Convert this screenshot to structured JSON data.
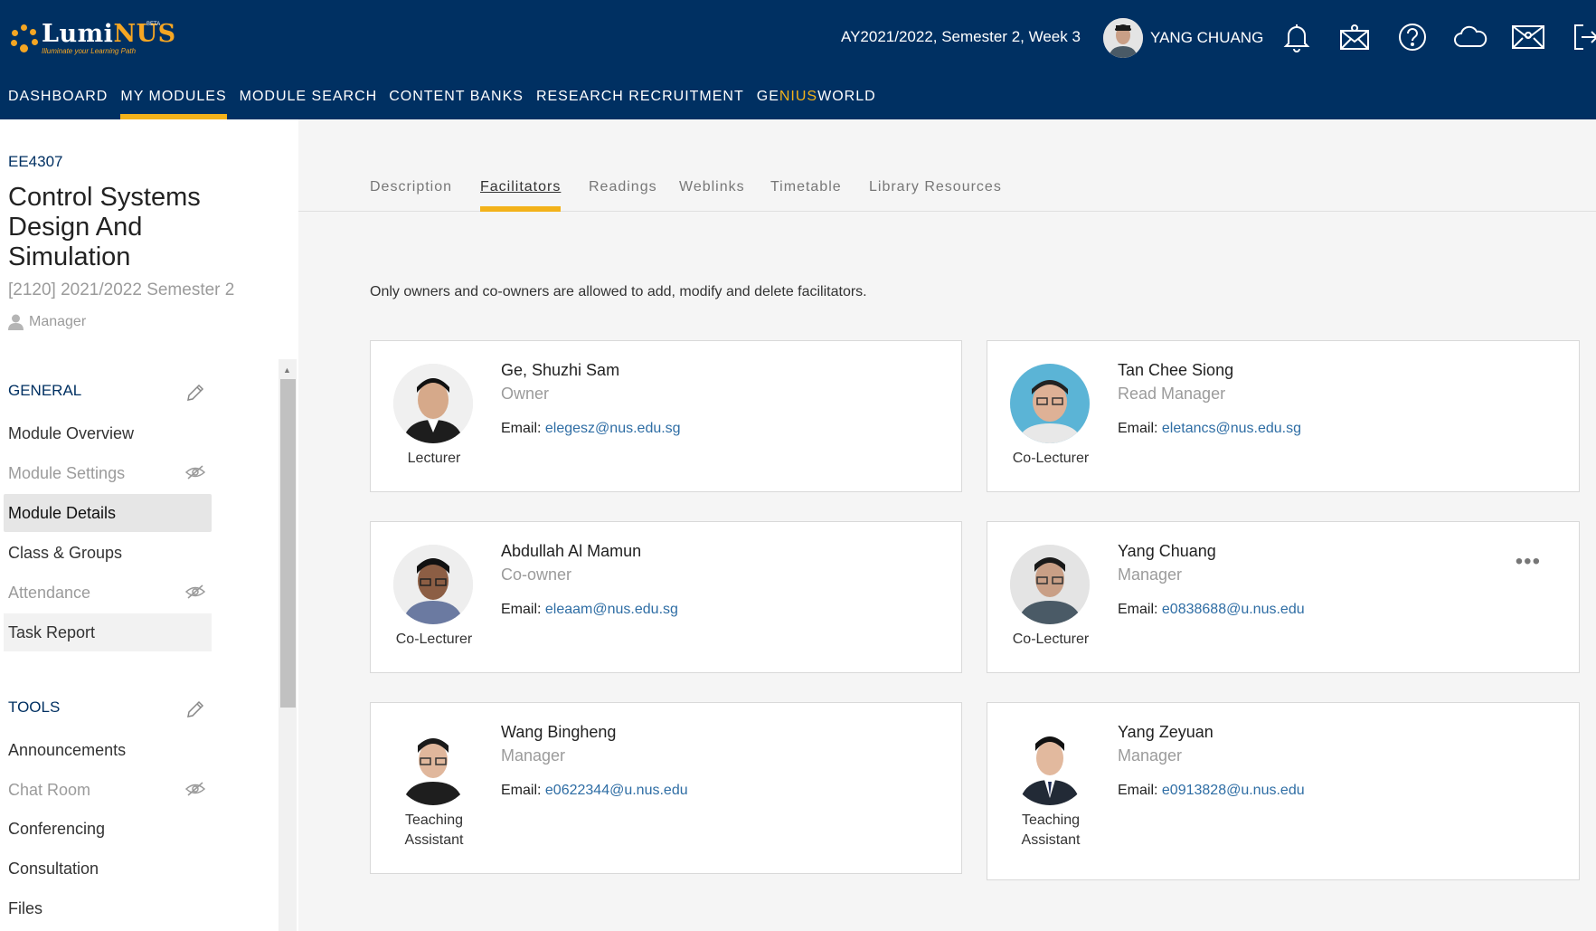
{
  "app": {
    "logo_main": "Lumi",
    "logo_nus": "NUS",
    "logo_beta": "BETA",
    "logo_tagline": "Illuminate your Learning Path"
  },
  "header": {
    "term": "AY2021/2022, Semester 2, Week 3",
    "user_name": "YANG CHUANG"
  },
  "nav": {
    "dashboard": "DASHBOARD",
    "my_modules": "MY MODULES",
    "module_search": "MODULE SEARCH",
    "content_banks": "CONTENT BANKS",
    "research_recruitment": "RESEARCH RECRUITMENT",
    "genius_a": "GE",
    "genius_b": "NIUS",
    "genius_c": "WORLD"
  },
  "module": {
    "code": "EE4307",
    "title": "Control Systems Design And Simulation",
    "term": "[2120] 2021/2022 Semester 2",
    "role": "Manager"
  },
  "sidebar": {
    "general_heading": "GENERAL",
    "general_items": [
      "Module Overview",
      "Module Settings",
      "Module Details",
      "Class & Groups",
      "Attendance",
      "Task Report"
    ],
    "tools_heading": "TOOLS",
    "tools_items": [
      "Announcements",
      "Chat Room",
      "Conferencing",
      "Consultation",
      "Files"
    ]
  },
  "tabs": {
    "description": "Description",
    "facilitators": "Facilitators",
    "readings": "Readings",
    "weblinks": "Weblinks",
    "timetable": "Timetable",
    "library": "Library Resources"
  },
  "notice": "Only owners and co-owners are allowed to add, modify and delete facilitators.",
  "email_label": "Email:",
  "facilitators": [
    {
      "name": "Ge, Shuzhi Sam",
      "role": "Owner",
      "title": "Lecturer",
      "email": "elegesz@nus.edu.sg"
    },
    {
      "name": "Tan Chee Siong",
      "role": "Read Manager",
      "title": "Co-Lecturer",
      "email": "eletancs@nus.edu.sg"
    },
    {
      "name": "Abdullah Al Mamun",
      "role": "Co-owner",
      "title": "Co-Lecturer",
      "email": "eleaam@nus.edu.sg"
    },
    {
      "name": "Yang Chuang",
      "role": "Manager",
      "title": "Co-Lecturer",
      "email": "e0838688@u.nus.edu"
    },
    {
      "name": "Wang Bingheng",
      "role": "Manager",
      "title_line1": "Teaching",
      "title_line2": "Assistant",
      "email": "e0622344@u.nus.edu"
    },
    {
      "name": "Yang Zeyuan",
      "role": "Manager",
      "title_line1": "Teaching",
      "title_line2": "Assistant",
      "email": "e0913828@u.nus.edu"
    }
  ],
  "colors": {
    "brand_navy": "#003062",
    "accent_yellow": "#f3b21a",
    "link_blue": "#2e6da4"
  }
}
